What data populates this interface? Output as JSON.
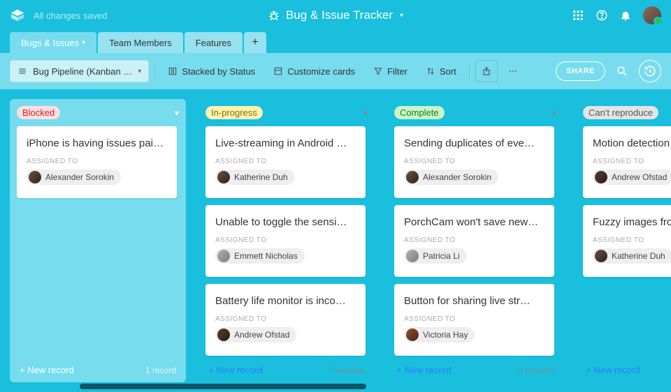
{
  "header": {
    "save_status": "All changes saved",
    "app_title": "Bug & Issue Tracker"
  },
  "tabs": {
    "items": [
      {
        "label": "Bugs & Issues",
        "active": true
      },
      {
        "label": "Team Members",
        "active": false
      },
      {
        "label": "Features",
        "active": false
      }
    ]
  },
  "toolbar": {
    "view_name": "Bug Pipeline (Kanban …",
    "stacked": "Stacked by Status",
    "customize": "Customize cards",
    "filter": "Filter",
    "sort": "Sort",
    "share": "SHARE"
  },
  "columns": [
    {
      "key": "blocked",
      "label": "Blocked",
      "badge_bg": "#ffdde1",
      "badge_fg": "#c62828",
      "selected": true,
      "footer": {
        "new": "+ New record",
        "count": "1 record"
      },
      "cards": [
        {
          "title": "iPhone is having issues pai…",
          "field": "ASSIGNED TO",
          "person": "Alexander Sorokin",
          "av": "c0"
        }
      ]
    },
    {
      "key": "inprogress",
      "label": "In-progress",
      "badge_bg": "#fff3b0",
      "badge_fg": "#8a6d00",
      "selected": false,
      "footer": {
        "new": "+ New record",
        "count": "7 records"
      },
      "cards": [
        {
          "title": "Live-streaming in Android …",
          "field": "ASSIGNED TO",
          "person": "Katherine Duh",
          "av": "c0"
        },
        {
          "title": "Unable to toggle the sensi…",
          "field": "ASSIGNED TO",
          "person": "Emmett Nicholas",
          "av": "c2"
        },
        {
          "title": "Battery life monitor is inco…",
          "field": "ASSIGNED TO",
          "person": "Andrew Ofstad",
          "av": "c3"
        }
      ]
    },
    {
      "key": "complete",
      "label": "Complete",
      "badge_bg": "#c8f7c5",
      "badge_fg": "#1b7a1f",
      "selected": false,
      "footer": {
        "new": "+ New record",
        "count": "3 records"
      },
      "cards": [
        {
          "title": "Sending duplicates of eve…",
          "field": "ASSIGNED TO",
          "person": "Alexander Sorokin",
          "av": "c0"
        },
        {
          "title": "PorchCam won't save new…",
          "field": "ASSIGNED TO",
          "person": "Patricia Li",
          "av": "c2"
        },
        {
          "title": "Button for sharing live str…",
          "field": "ASSIGNED TO",
          "person": "Victoria Hay",
          "av": "c4"
        }
      ]
    },
    {
      "key": "cantrepro",
      "label": "Can't reproduce",
      "badge_bg": "#e4e4e4",
      "badge_fg": "#555",
      "selected": false,
      "footer": {
        "new": "+ New record",
        "count": ""
      },
      "cards": [
        {
          "title": "Motion detection",
          "field": "ASSIGNED TO",
          "person": "Andrew Ofstad",
          "av": "c3"
        },
        {
          "title": "Fuzzy images fro",
          "field": "ASSIGNED TO",
          "person": "Katherine Duh",
          "av": "c0"
        }
      ]
    }
  ]
}
